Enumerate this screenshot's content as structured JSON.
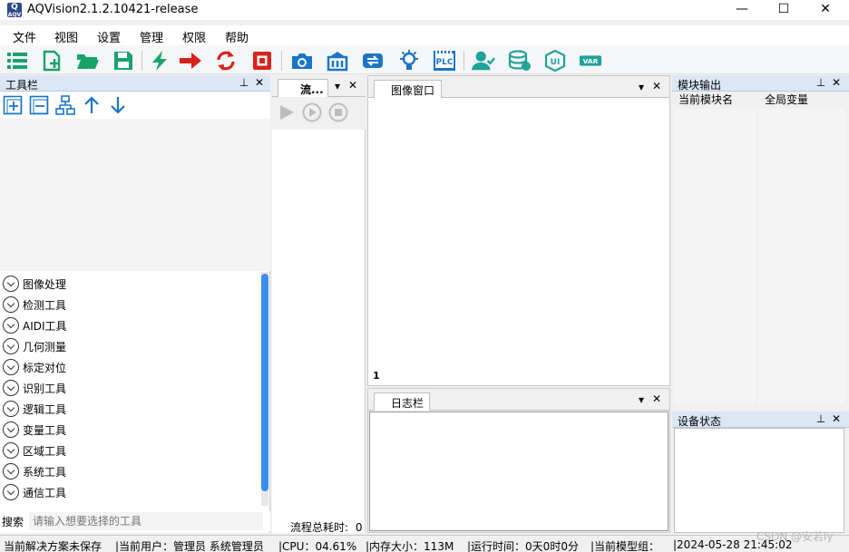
{
  "window": {
    "title": "AQVision2.1.2.10421-release",
    "icon_text": "Q",
    "icon_subtext": "AQV",
    "minimize": "—",
    "maximize": "☐",
    "close": "✕"
  },
  "menu": [
    "文件",
    "视图",
    "设置",
    "管理",
    "权限",
    "帮助"
  ],
  "toolbar": {
    "icons": [
      "list-icon",
      "new-file-icon",
      "open-folder-icon",
      "save-icon",
      "run-once-icon",
      "run-continuous-icon",
      "loop-icon",
      "stop-icon",
      "camera-icon",
      "io-card-icon",
      "communication-icon",
      "light-icon",
      "plc-icon",
      "user-icon",
      "database-icon",
      "ui-icon",
      "var-icon"
    ],
    "plc_text": "PLC",
    "ui_text": "UI",
    "var_text": "VAR"
  },
  "toolbox": {
    "title": "工具栏",
    "pin": "⊥",
    "close": "✕",
    "categories": [
      "图像处理",
      "检测工具",
      "AIDI工具",
      "几何测量",
      "标定对位",
      "识别工具",
      "逻辑工具",
      "变量工具",
      "区域工具",
      "系统工具",
      "通信工具"
    ],
    "search_label": "搜索",
    "search_placeholder": "请输入想要选择的工具"
  },
  "flow": {
    "tab": "流...",
    "dropdown": "▾",
    "close": "✕",
    "time_label": "流程总耗时:",
    "time_value": "0"
  },
  "image_window": {
    "tab": "图像窗口",
    "dropdown": "▾",
    "close": "✕",
    "index": "1"
  },
  "log": {
    "tab": "日志栏",
    "dropdown": "▾",
    "close": "✕"
  },
  "module_output": {
    "title": "模块输出",
    "pin": "⊥",
    "close": "✕",
    "columns": [
      "当前模块名",
      "全局变量"
    ]
  },
  "device_status": {
    "title": "设备状态",
    "pin": "⊥",
    "close": "✕"
  },
  "status": {
    "solution": "当前解决方案未保存",
    "user": "|当前用户：管理员 系统管理员",
    "cpu": "|CPU：04.61%",
    "memory": "|内存大小：113M",
    "runtime": "|运行时间：0天0时0分",
    "model": "|当前模型组：",
    "datetime": "|2024-05-28 21:45:02"
  },
  "watermark": "CSDN @安若ly",
  "colors": {
    "accent_blue": "#1a75c8",
    "green": "#19a36b",
    "teal": "#1fa39a",
    "red": "#d8231c",
    "scroll_thumb": "#3c8ef0"
  }
}
